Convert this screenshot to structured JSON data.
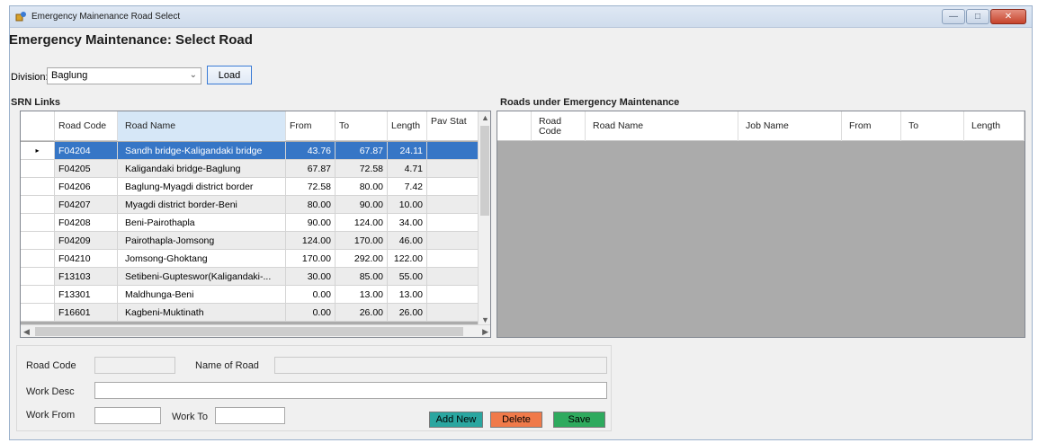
{
  "window": {
    "title": "Emergency Mainenance Road Select",
    "controls": {
      "minimize": "—",
      "maximize": "□",
      "close": "✕"
    }
  },
  "page_title": "Emergency Maintenance: Select Road",
  "division": {
    "label": "Division:",
    "value": "Baglung",
    "load_label": "Load"
  },
  "srn": {
    "label": "SRN Links",
    "columns": [
      "Road Code",
      "Road Name",
      "From",
      "To",
      "Length",
      "Pav Stat"
    ],
    "rows": [
      {
        "code": "F04204",
        "name": "Sandh bridge-Kaligandaki bridge",
        "from": "43.76",
        "to": "67.87",
        "length": "24.11"
      },
      {
        "code": "F04205",
        "name": "Kaligandaki bridge-Baglung",
        "from": "67.87",
        "to": "72.58",
        "length": "4.71"
      },
      {
        "code": "F04206",
        "name": "Baglung-Myagdi district border",
        "from": "72.58",
        "to": "80.00",
        "length": "7.42"
      },
      {
        "code": "F04207",
        "name": "Myagdi district border-Beni",
        "from": "80.00",
        "to": "90.00",
        "length": "10.00"
      },
      {
        "code": "F04208",
        "name": "Beni-Pairothapla",
        "from": "90.00",
        "to": "124.00",
        "length": "34.00"
      },
      {
        "code": "F04209",
        "name": "Pairothapla-Jomsong",
        "from": "124.00",
        "to": "170.00",
        "length": "46.00"
      },
      {
        "code": "F04210",
        "name": "Jomsong-Ghoktang",
        "from": "170.00",
        "to": "292.00",
        "length": "122.00"
      },
      {
        "code": "F13103",
        "name": "Setibeni-Gupteswor(Kaligandaki-...",
        "from": "30.00",
        "to": "85.00",
        "length": "55.00"
      },
      {
        "code": "F13301",
        "name": "Maldhunga-Beni",
        "from": "0.00",
        "to": "13.00",
        "length": "13.00"
      },
      {
        "code": "F16601",
        "name": "Kagbeni-Muktinath",
        "from": "0.00",
        "to": "26.00",
        "length": "26.00"
      }
    ],
    "selected_row_marker": "▸"
  },
  "emergency": {
    "label": "Roads under Emergency Maintenance",
    "columns": [
      "Road Code",
      "Road Name",
      "Job Name",
      "From",
      "To",
      "Length"
    ]
  },
  "form": {
    "road_code_label": "Road Code",
    "road_name_label": "Name of Road",
    "work_desc_label": "Work Desc",
    "work_from_label": "Work From",
    "work_to_label": "Work To",
    "add_new_label": "Add New",
    "delete_label": "Delete",
    "save_label": "Save"
  },
  "colors": {
    "selection": "#3676c6",
    "add_new": "#2aa6a0",
    "delete": "#f07a4a",
    "save": "#2eaa5e"
  }
}
